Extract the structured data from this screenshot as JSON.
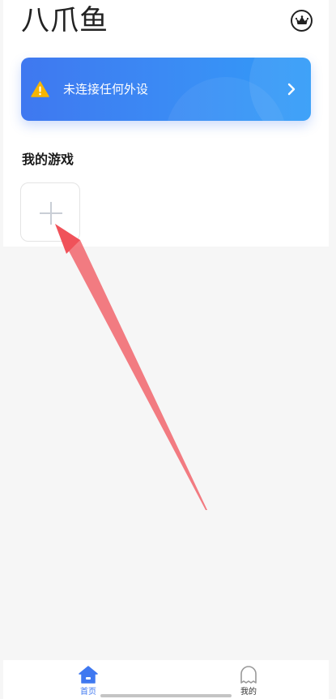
{
  "header": {
    "title": "八爪鱼",
    "crown_icon": "crown-icon"
  },
  "device_card": {
    "status_text": "未连接任何外设",
    "warning_icon": "warning-icon",
    "chevron_icon": "chevron-right-icon",
    "gradient_start": "#3f78f0",
    "gradient_end": "#2f9bf8"
  },
  "my_games": {
    "section_title": "我的游戏",
    "add_icon": "plus-icon"
  },
  "tab_bar": {
    "tabs": [
      {
        "label": "首页",
        "icon": "home-icon",
        "active": true
      },
      {
        "label": "我的",
        "icon": "ghost-icon",
        "active": false
      }
    ],
    "active_color": "#3f78f0"
  },
  "annotation": {
    "arrow_color": "#f0525a"
  }
}
